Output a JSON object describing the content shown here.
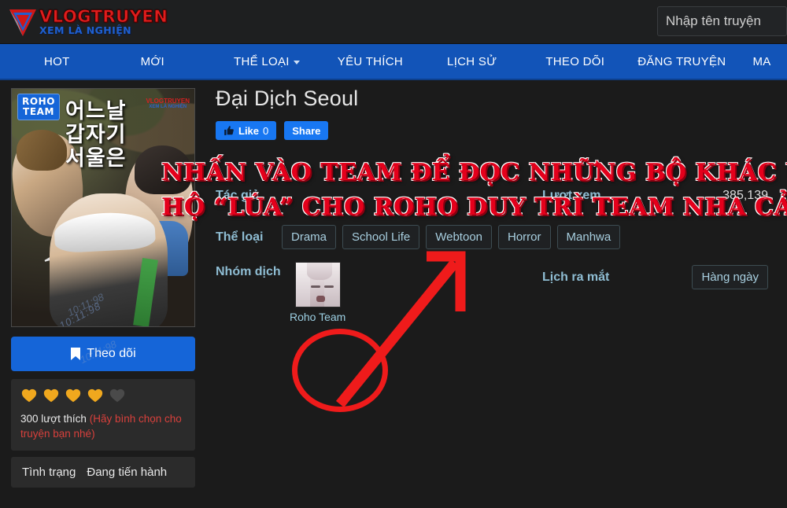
{
  "header": {
    "logo_main": "VLOGTRUYEN",
    "logo_sub": "XEM LÀ NGHIỆN",
    "search_placeholder": "Nhập tên truyện",
    "search_value": ""
  },
  "nav": {
    "items": [
      {
        "label": "HOT",
        "has_caret": false
      },
      {
        "label": "MỚI",
        "has_caret": false
      },
      {
        "label": "THỂ LOẠI",
        "has_caret": true
      },
      {
        "label": "YÊU THÍCH",
        "has_caret": false
      },
      {
        "label": "LỊCH SỬ",
        "has_caret": false
      },
      {
        "label": "THEO DÕI",
        "has_caret": false
      },
      {
        "label": "ĐĂNG TRUYỆN",
        "has_caret": false
      },
      {
        "label": "MA",
        "has_caret": false
      }
    ]
  },
  "cover": {
    "team_badge": "ROHO\nTEAM",
    "team_badge_line1": "ROHO",
    "team_badge_line2": "TEAM",
    "korean_title_line1": "어느날",
    "korean_title_line2": "갑자기",
    "korean_title_line3": "서울은",
    "watermark_main": "VLOGTRUYEN",
    "watermark_sub": "XEM LÀ NGHIỆN",
    "code": "10:11:98"
  },
  "sidebar": {
    "follow_label": "Theo dõi",
    "follow_icon": "bookmark-icon",
    "rating": {
      "filled": 4,
      "total": 5
    },
    "likes_count_text": "300 lượt thích",
    "likes_hint": "(Hãy bình chọn cho truyện bạn nhé)",
    "status_label": "Tình trạng",
    "status_value": "Đang tiến hành"
  },
  "detail": {
    "title": "Đại Dịch Seoul",
    "like_button": {
      "label": "Like",
      "count": "0",
      "icon": "thumbs-up-icon"
    },
    "share_button": {
      "label": "Share"
    },
    "author_label": "Tác giả",
    "author_value": "",
    "views_label": "Lượt xem",
    "views_value": "385,139",
    "genres_label": "Thể loại",
    "genres": [
      "Drama",
      "School Life",
      "Webtoon",
      "Horror",
      "Manhwa"
    ],
    "group_label": "Nhóm dịch",
    "group_name": "Roho Team",
    "schedule_label": "Lịch ra mắt",
    "schedule_value": "Hàng ngày"
  },
  "annotation": {
    "banner_line1": "NHẤN VÀO TEAM ĐỂ ĐỌC NHỮNG BỘ KHÁC ỦNG",
    "banner_line2": "HỘ “LÚA” CHO ROHO DUY TRÌ TEAM NHA CẢ NHÀ!!",
    "arrow": "red-arrow-pointing-up-right",
    "circle": "red-circle-around-roho-team"
  },
  "watermarks": {
    "left": "10:11:98",
    "mid": "10:11:98"
  },
  "colors": {
    "nav_blue": "#1254b8",
    "accent_red": "#e4001b",
    "label_blue": "#8fbdd3",
    "heart_gold": "#f0a81e",
    "facebook_blue": "#1877f2"
  }
}
